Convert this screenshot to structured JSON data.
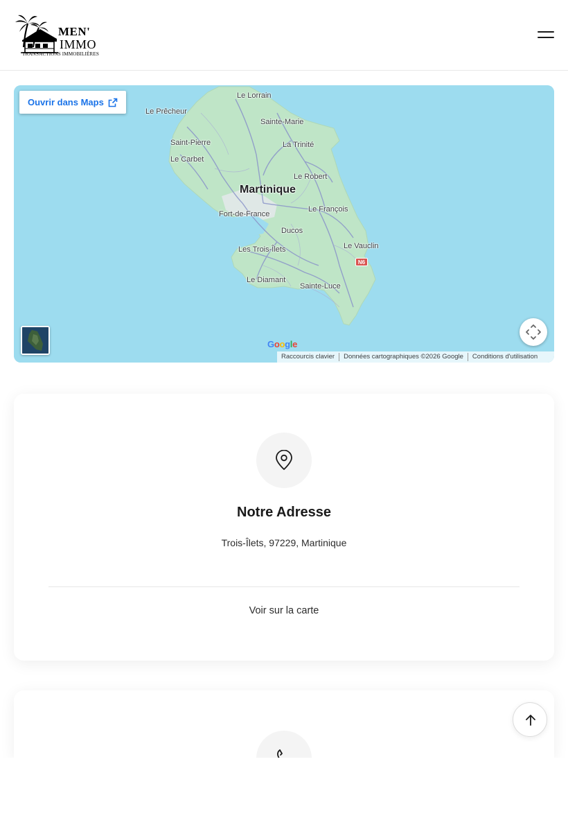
{
  "header": {
    "logo_line1": "MEN'",
    "logo_line2": "IMMO",
    "logo_tagline": "TRANSACTIONS IMMOBILIÈRES",
    "menu_icon": "hamburger-icon"
  },
  "map": {
    "open_in_maps_label": "Ouvrir dans Maps",
    "open_icon": "external-link-icon",
    "labels": {
      "le_lorrain": "Le Lorrain",
      "le_precheur": "Le Prêcheur",
      "sainte_marie": "Sainte-Marie",
      "saint_pierre": "Saint-Pierre",
      "la_trinite": "La Trinité",
      "le_carbet": "Le Carbet",
      "le_robert": "Le Robert",
      "martinique": "Martinique",
      "le_francois": "Le François",
      "fort_de_france": "Fort-de-France",
      "ducos": "Ducos",
      "le_vauclin": "Le Vauclin",
      "les_trois_ilets": "Les Trois-Îlets",
      "le_diamant": "Le Diamant",
      "sainte_luce": "Sainte-Luce"
    },
    "route_badge": "N6",
    "google_logo": "Google",
    "attribution": {
      "shortcuts": "Raccourcis clavier",
      "data": "Données cartographiques ©2026 Google",
      "terms": "Conditions d'utilisation"
    },
    "fullscreen_icon": "fullscreen-icon",
    "colors": {
      "water": "#9ddcef",
      "land": "#bfe5c7",
      "roads": "#8b95c9"
    }
  },
  "address_card": {
    "icon": "map-pin-icon",
    "title": "Notre Adresse",
    "address": "Trois-Îlets, 97229, Martinique",
    "link": "Voir sur la carte"
  },
  "phone_card": {
    "icon": "phone-icon"
  },
  "scroll_top_icon": "arrow-up-icon"
}
